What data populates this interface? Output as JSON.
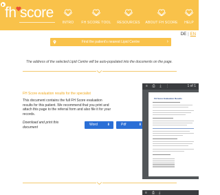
{
  "header": {
    "logo_fh": "fh",
    "logo_score": "score",
    "colors": {
      "brand": "#f9c24a",
      "accent": "#f0a81d",
      "button_blue": "#2b6fd6"
    },
    "nav": [
      {
        "label": "Intro",
        "icon": "heart-hands-icon"
      },
      {
        "label": "FH score tool",
        "icon": "heart-hands-icon"
      },
      {
        "label": "Resources",
        "icon": "heart-hands-icon"
      },
      {
        "label": "About FH score",
        "icon": "heart-hands-icon"
      },
      {
        "label": "Help",
        "icon": "heart-hands-icon"
      }
    ]
  },
  "language": {
    "de": "DE",
    "separator": "|",
    "en": "EN"
  },
  "find_centre": {
    "label": "Find the patient's nearest Lipid Centre"
  },
  "auto_populate_text": "The address of the selected Lipid Centre will be auto-populated into the documents on the page.",
  "results": {
    "title": "FH Score evaluation results for the specialist",
    "body": "This document contains the full FH Score evaluation results for this patient. We recommend that you print and attach this page to the referral form and also file it for your records.",
    "download_text": "Download and print this document",
    "buttons": [
      {
        "label": "Word"
      },
      {
        "label": "Pdf"
      }
    ]
  },
  "preview": {
    "page_indicator": "1 of 1",
    "doc_title": "FH Score Evaluation Results"
  }
}
